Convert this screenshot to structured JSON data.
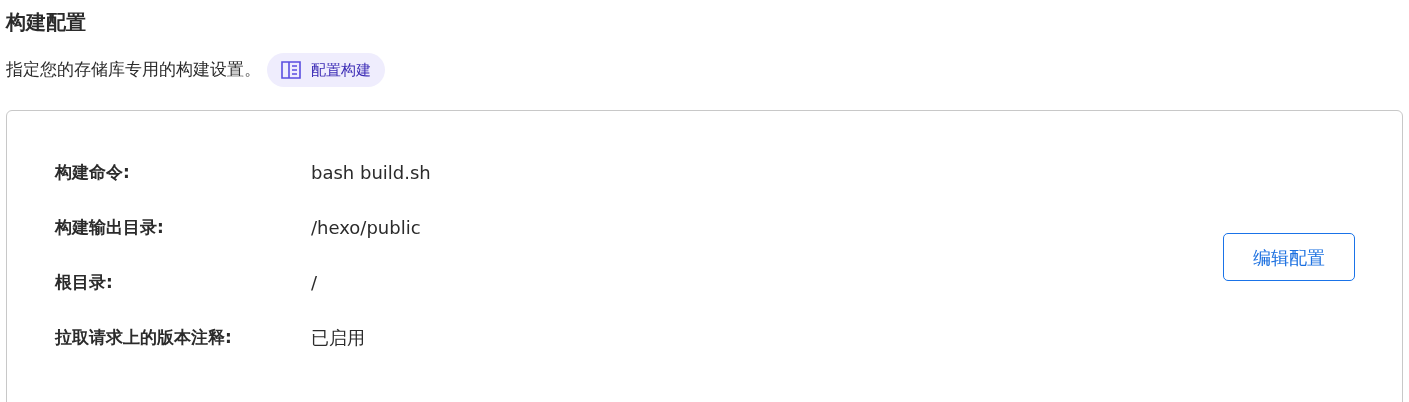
{
  "title": "构建配置",
  "description": "指定您的存储库专用的构建设置。",
  "doc_link": {
    "label": "配置构建"
  },
  "settings": [
    {
      "label": "构建命令:",
      "value": "bash build.sh"
    },
    {
      "label": "构建输出目录:",
      "value": "/hexo/public"
    },
    {
      "label": "根目录:",
      "value": "/"
    },
    {
      "label": "拉取请求上的版本注释:",
      "value": "已启用"
    }
  ],
  "edit_button": {
    "label": "编辑配置"
  }
}
